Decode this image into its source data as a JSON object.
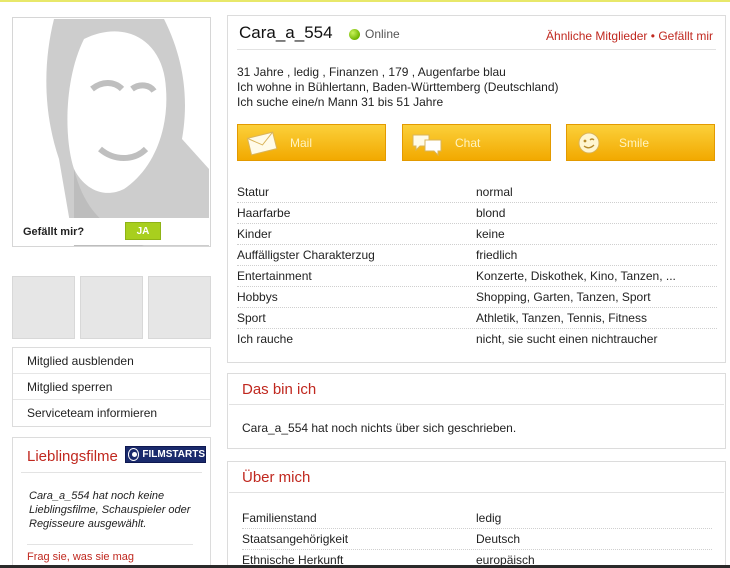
{
  "profile": {
    "username": "Cara_a_554",
    "status": "Online",
    "links": {
      "similar": "Ähnliche Mitglieder",
      "separator": "•",
      "like": "Gefällt mir"
    },
    "summary": [
      "31 Jahre , ledig , Finanzen , 179 , Augenfarbe blau",
      "Ich wohne in Bühlertann, Baden-Württemberg (Deutschland)",
      "Ich suche eine/n Mann 31 bis 51 Jahre"
    ],
    "actions": [
      {
        "label": "Mail",
        "icon": "mail-icon"
      },
      {
        "label": "Chat",
        "icon": "chat-icon"
      },
      {
        "label": "Smile",
        "icon": "smile-icon"
      }
    ],
    "details": [
      {
        "key": "Statur",
        "value": "normal"
      },
      {
        "key": "Haarfarbe",
        "value": "blond"
      },
      {
        "key": "Kinder",
        "value": "keine"
      },
      {
        "key": "Auffälligster Charakterzug",
        "value": "friedlich"
      },
      {
        "key": "Entertainment",
        "value": "Konzerte, Diskothek, Kino, Tanzen, ..."
      },
      {
        "key": "Hobbys",
        "value": "Shopping, Garten, Tanzen, Sport"
      },
      {
        "key": "Sport",
        "value": "Athletik, Tanzen, Tennis, Fitness"
      },
      {
        "key": "Ich rauche",
        "value": "nicht, sie sucht einen nichtraucher"
      }
    ]
  },
  "photo": {
    "like_label": "Gefällt mir?",
    "like_button": "JA"
  },
  "left_menu": [
    "Mitglied ausblenden",
    "Mitglied sperren",
    "Serviceteam informieren"
  ],
  "favorites": {
    "title": "Lieblingsfilme",
    "brand": "FILMSTARTS",
    "empty_text": "Cara_a_554 hat noch keine Lieblingsfilme, Schauspieler oder Regisseure ausgewählt.",
    "ask_link": "Frag sie, was sie mag"
  },
  "about": {
    "title": "Das bin ich",
    "text": "Cara_a_554 hat noch nichts über sich geschrieben."
  },
  "about_me": {
    "title": "Über mich",
    "details": [
      {
        "key": "Familienstand",
        "value": "ledig"
      },
      {
        "key": "Staatsangehörigkeit",
        "value": "Deutsch"
      },
      {
        "key": "Ethnische Herkunft",
        "value": "europäisch"
      }
    ]
  },
  "colors": {
    "accent_red": "#c0281f",
    "button_orange": "#f2a900",
    "online_green": "#6fb400",
    "like_green": "#a8cf1e"
  }
}
